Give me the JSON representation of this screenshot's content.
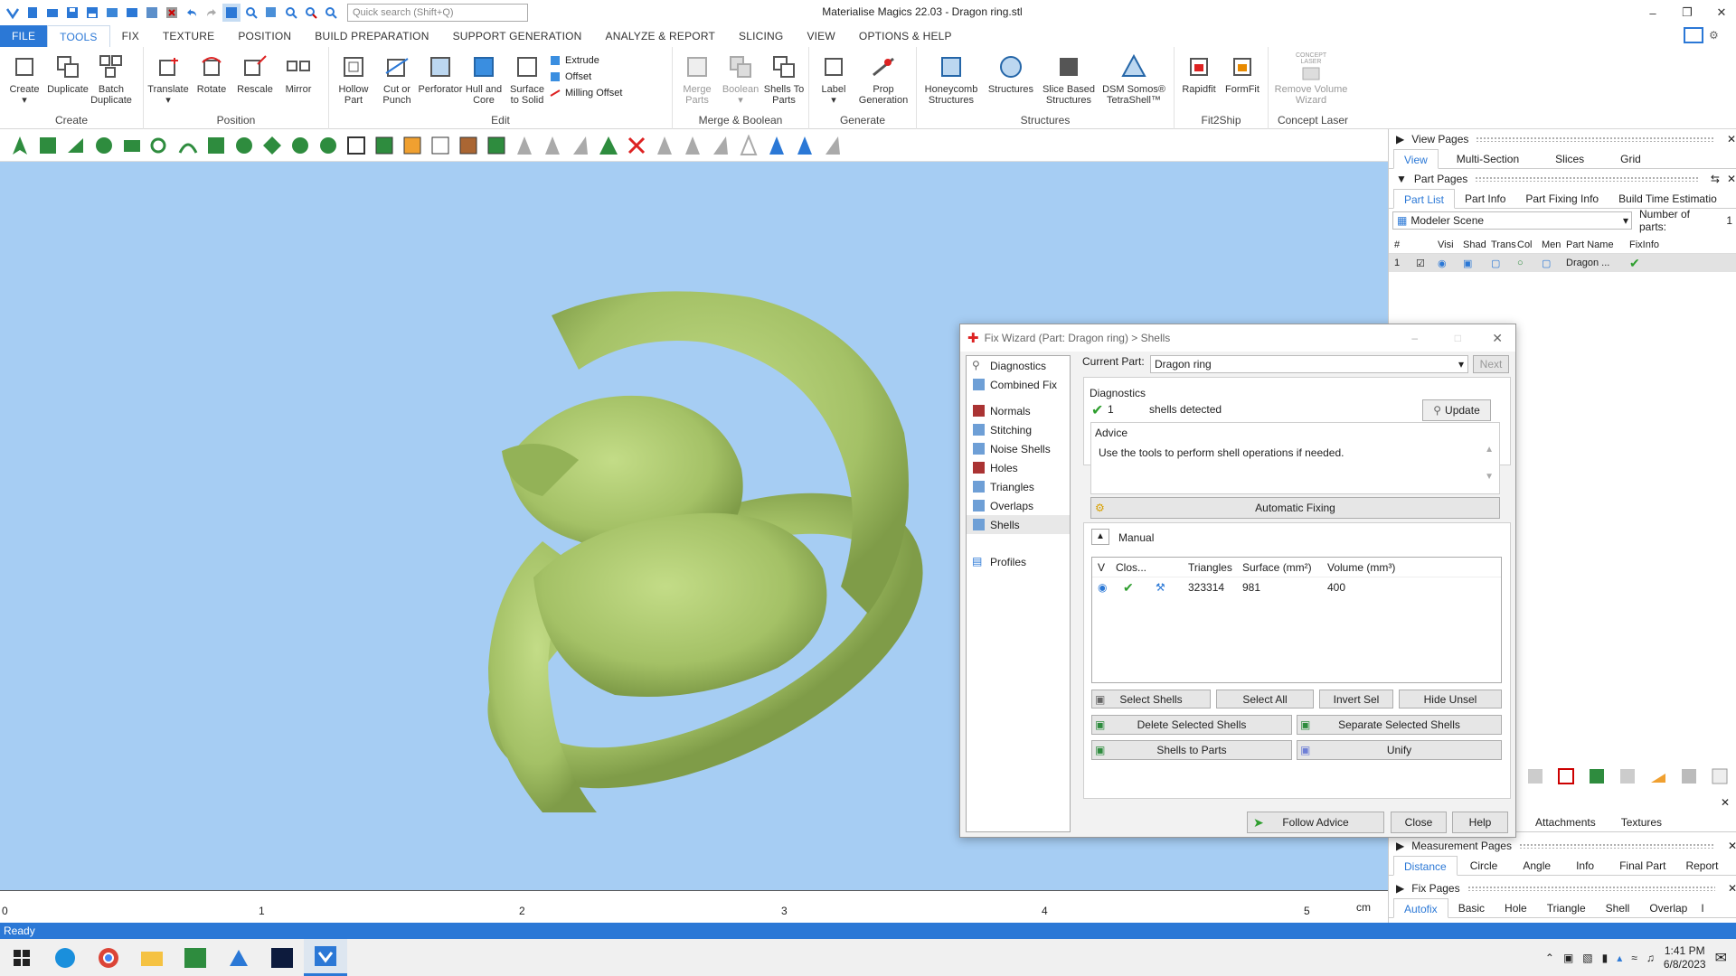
{
  "app": {
    "title": "Materialise Magics 22.03 - Dragon ring.stl",
    "search_placeholder": "Quick search (Shift+Q)"
  },
  "menu": [
    "FILE",
    "TOOLS",
    "FIX",
    "TEXTURE",
    "POSITION",
    "BUILD PREPARATION",
    "SUPPORT GENERATION",
    "ANALYZE & REPORT",
    "SLICING",
    "VIEW",
    "OPTIONS & HELP"
  ],
  "ribbon": {
    "create": {
      "label": "Create",
      "buttons": [
        "Create",
        "Duplicate",
        "Batch Duplicate"
      ]
    },
    "position": {
      "label": "Position",
      "buttons": [
        "Translate",
        "Rotate",
        "Rescale",
        "Mirror"
      ]
    },
    "edit": {
      "label": "Edit",
      "buttons": [
        "Hollow Part",
        "Cut or Punch",
        "Perforator",
        "Hull and Core",
        "Surface to Solid"
      ],
      "small": [
        "Extrude",
        "Offset",
        "Milling Offset"
      ]
    },
    "merge": {
      "label": "Merge & Boolean",
      "buttons": [
        "Merge Parts",
        "Boolean",
        "Shells To Parts"
      ]
    },
    "generate": {
      "label": "Generate",
      "buttons": [
        "Label",
        "Prop Generation"
      ]
    },
    "structures": {
      "label": "Structures",
      "buttons": [
        "Honeycomb Structures",
        "Structures",
        "Slice Based Structures",
        "DSM Somos® TetraShell™"
      ]
    },
    "fit2ship": {
      "label": "Fit2Ship",
      "buttons": [
        "Rapidfit",
        "FormFit"
      ]
    },
    "concept": {
      "label": "Concept Laser",
      "buttons": [
        "Remove Volume Wizard"
      ],
      "logo": "CONCEPT LASER"
    }
  },
  "ruler": {
    "ticks": [
      "0",
      "1",
      "2",
      "3",
      "4",
      "5"
    ],
    "unit": "cm"
  },
  "status": "Ready",
  "right": {
    "view_pages": "View Pages",
    "view_tabs": [
      "View",
      "Multi-Section",
      "Slices",
      "Grid"
    ],
    "part_pages": "Part Pages",
    "part_tabs": [
      "Part List",
      "Part Info",
      "Part Fixing Info",
      "Build Time Estimatio"
    ],
    "scene": "Modeler Scene",
    "num_parts_label": "Number of parts:",
    "num_parts": "1",
    "cols": [
      "#",
      "",
      "Visi",
      "Shad",
      "Trans",
      "Col",
      "Men",
      "Part Name",
      "FixInfo"
    ],
    "row": {
      "num": "1",
      "name": "Dragon ..."
    },
    "lower_tabs": [
      "Attachments",
      "Textures"
    ],
    "measurement_pages": "Measurement Pages",
    "measure_tabs": [
      "Distance",
      "Circle",
      "Angle",
      "Info",
      "Final Part",
      "Report"
    ],
    "fix_pages": "Fix Pages",
    "fix_tabs": [
      "Autofix",
      "Basic",
      "Hole",
      "Triangle",
      "Shell",
      "Overlap",
      "I"
    ]
  },
  "dialog": {
    "title": "Fix Wizard (Part: Dragon ring) > Shells",
    "left_items": [
      "Diagnostics",
      "Combined Fix",
      "Normals",
      "Stitching",
      "Noise Shells",
      "Holes",
      "Triangles",
      "Overlaps",
      "Shells",
      "Profiles"
    ],
    "current_part_label": "Current Part:",
    "current_part": "Dragon ring",
    "next": "Next",
    "diagnostics_label": "Diagnostics",
    "diag_count": "1",
    "diag_text": "shells detected",
    "update": "Update",
    "advice_label": "Advice",
    "advice_text": "Use the tools to perform shell operations if needed.",
    "automatic_fixing": "Automatic Fixing",
    "manual_label": "Manual",
    "table_headers": [
      "V",
      "Clos...",
      "",
      "Triangles",
      "Surface (mm²)",
      "Volume (mm³)"
    ],
    "table_row": {
      "triangles": "323314",
      "surface": "981",
      "volume": "400"
    },
    "buttons": {
      "select_shells": "Select Shells",
      "select_all": "Select All",
      "invert_sel": "Invert Sel",
      "hide_unsel": "Hide Unsel",
      "delete_selected": "Delete Selected Shells",
      "separate_selected": "Separate Selected Shells",
      "shells_to_parts": "Shells to Parts",
      "unify": "Unify",
      "follow_advice": "Follow Advice",
      "close": "Close",
      "help": "Help"
    }
  },
  "taskbar": {
    "time": "1:41 PM",
    "date": "6/8/2023"
  },
  "colors": {
    "accent": "#2b78d6",
    "viewport": "#a6cdf3",
    "model": "#a8c66c",
    "check": "#2e9e2e"
  }
}
